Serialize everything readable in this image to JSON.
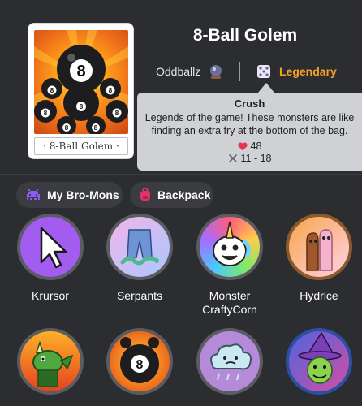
{
  "monster": {
    "name": "8-Ball Golem",
    "card_name": "8-Ball Golem",
    "set_name": "Oddballz",
    "rarity": "Legendary",
    "rarity_color": "#f6a22a",
    "icons": {
      "set": "crystal-ball-icon",
      "rarity": "dice-icon"
    }
  },
  "tooltip": {
    "title": "Crush",
    "description_line1": "Legends of the game! These monsters are like",
    "description_line2": "finding an extra fry at the bottom of the bag.",
    "health": "48",
    "attack": "11 - 18",
    "icons": {
      "health": "heart-icon",
      "attack": "crossed-swords-icon"
    }
  },
  "tabs": [
    {
      "label": "My Bro-Mons",
      "icon": "space-invader-icon"
    },
    {
      "label": "Backpack",
      "icon": "backpack-icon"
    }
  ],
  "monsters": [
    {
      "label": "Krursor"
    },
    {
      "label": "Serpants"
    },
    {
      "label_line1": "Monster",
      "label_line2": "CraftyCorn"
    },
    {
      "label": "Hydrlce"
    },
    {
      "label": ""
    },
    {
      "label": ""
    },
    {
      "label": ""
    },
    {
      "label": ""
    }
  ]
}
